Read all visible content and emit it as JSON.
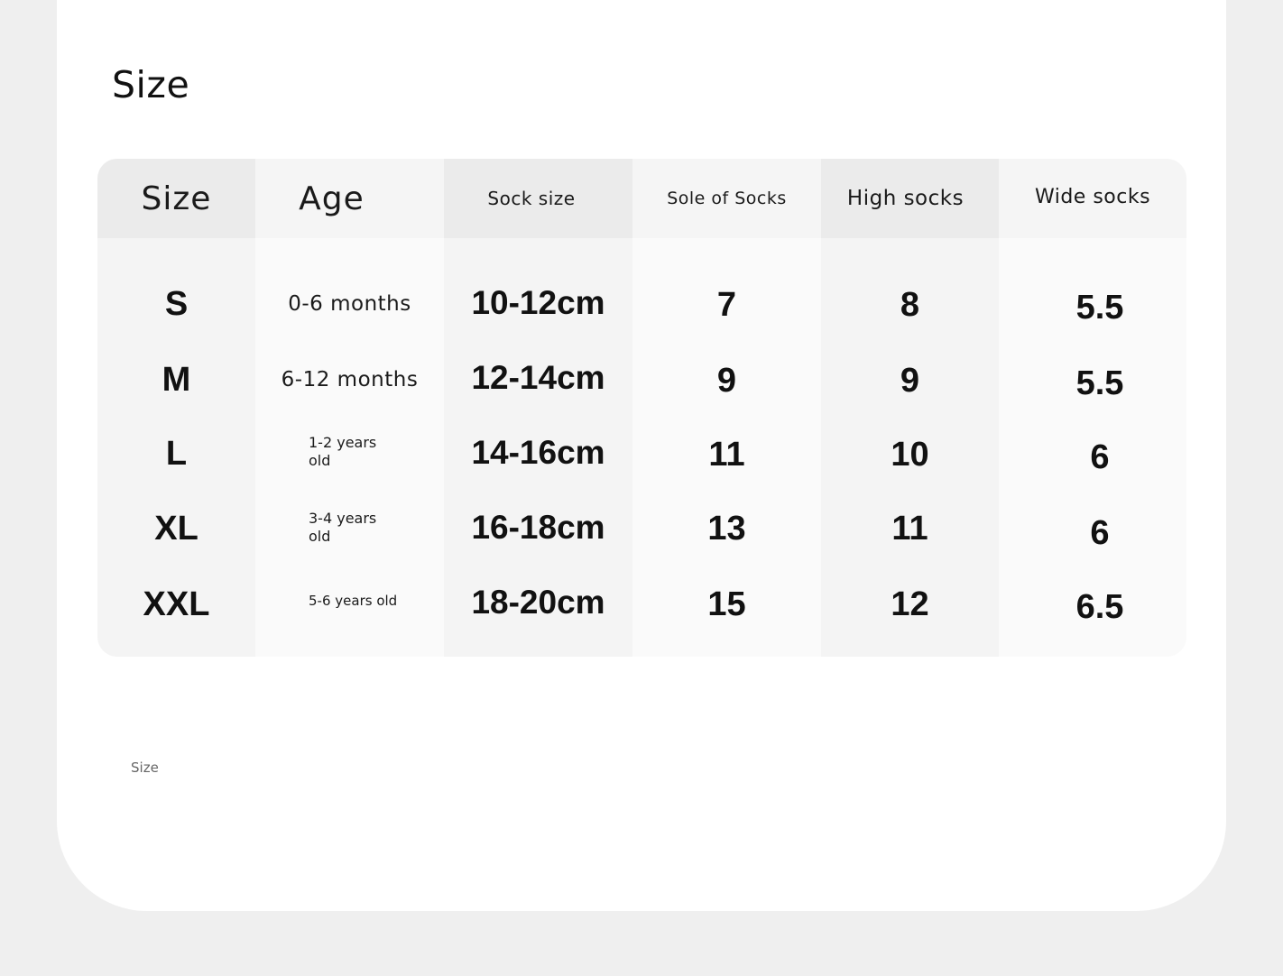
{
  "title": "Size",
  "footer": "Size",
  "table": {
    "headers": [
      "Size",
      "Age",
      "Sock size",
      "Sole of Socks",
      "High socks",
      "Wide socks"
    ],
    "rows": [
      {
        "size": "S",
        "age": "0-6 months",
        "sock_size": "10-12cm",
        "sole": "7",
        "high": "8",
        "wide": "5.5"
      },
      {
        "size": "M",
        "age": "6-12 months",
        "sock_size": "12-14cm",
        "sole": "9",
        "high": "9",
        "wide": "5.5"
      },
      {
        "size": "L",
        "age": "1-2 years old",
        "sock_size": "14-16cm",
        "sole": "11",
        "high": "10",
        "wide": "6"
      },
      {
        "size": "XL",
        "age": "3-4 years old",
        "sock_size": "16-18cm",
        "sole": "13",
        "high": "11",
        "wide": "6"
      },
      {
        "size": "XXL",
        "age": "5-6 years old",
        "sock_size": "18-20cm",
        "sole": "15",
        "high": "12",
        "wide": "6.5"
      }
    ]
  },
  "colors": {
    "page_bg": "#efefef",
    "card_bg": "#ffffff",
    "header_dark": "#ebebeb",
    "header_light": "#f5f5f5",
    "body_dark": "#f4f4f4",
    "body_light": "#fafafa"
  }
}
